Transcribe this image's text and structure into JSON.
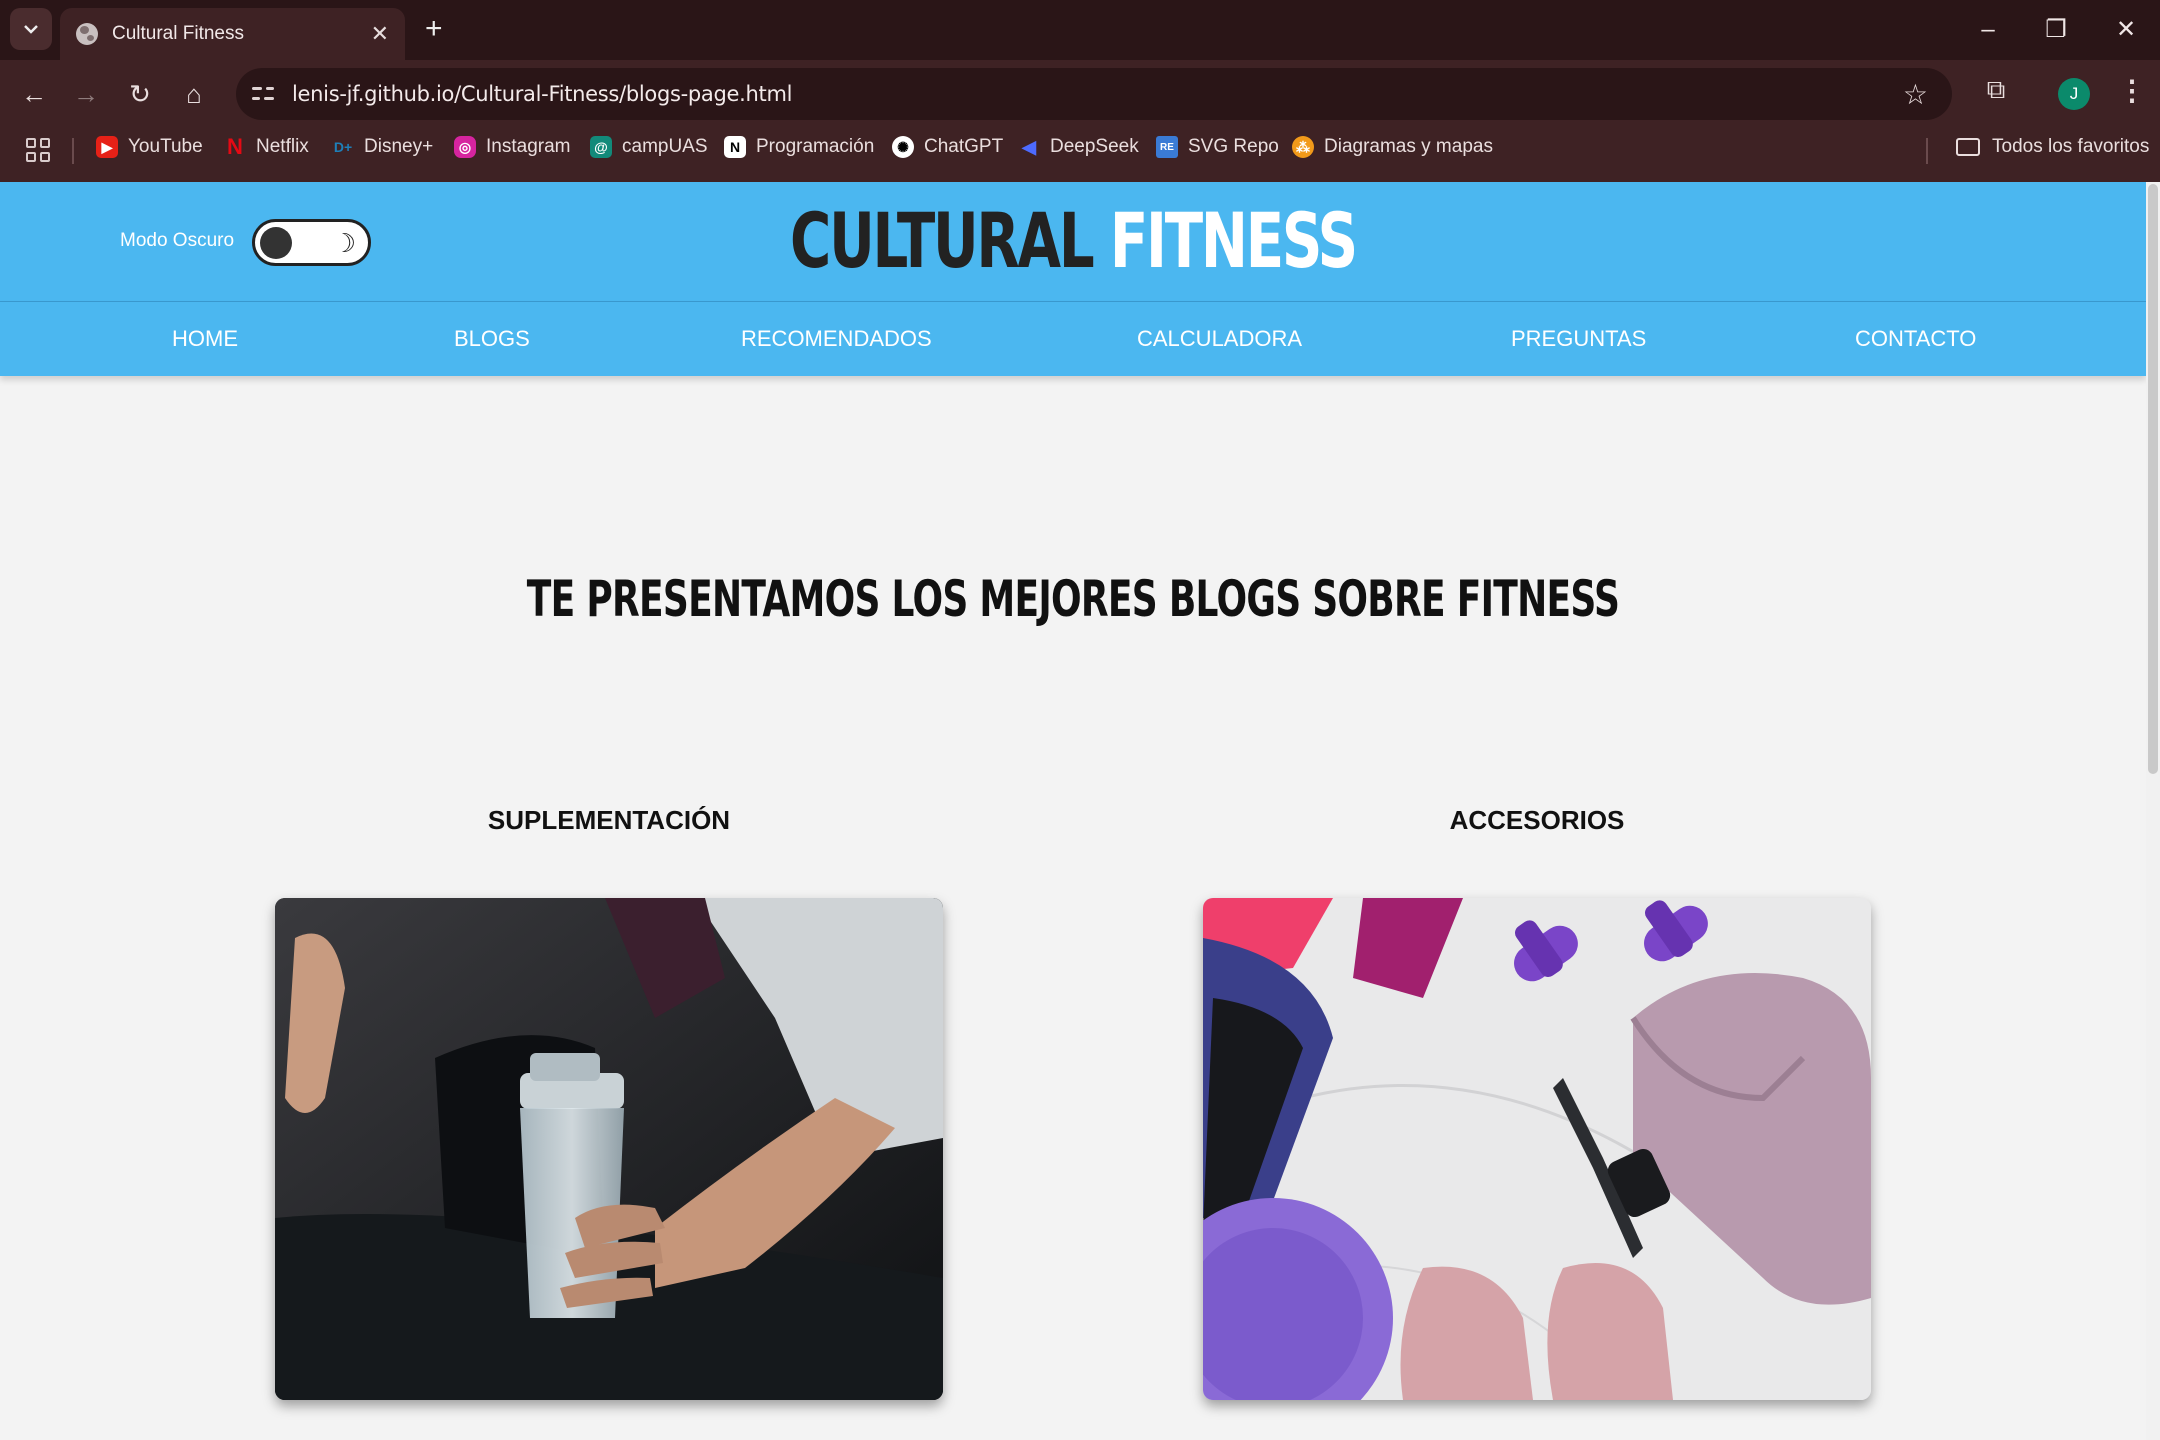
{
  "browser": {
    "tab_title": "Cultural Fitness",
    "url": "lenis-jf.github.io/Cultural-Fitness/blogs-page.html",
    "profile_initial": "J",
    "bookmarks": [
      "YouTube",
      "Netflix",
      "Disney+",
      "Instagram",
      "campUAS",
      "Programación",
      "ChatGPT",
      "DeepSeek",
      "SVG Repo",
      "Diagramas y mapas"
    ],
    "all_bookmarks": "Todos los favoritos"
  },
  "header": {
    "toggle_label": "Modo Oscuro",
    "brand_part1": "CULTURAL",
    "brand_part2": "FITNESS",
    "nav": [
      "HOME",
      "BLOGS",
      "RECOMENDADOS",
      "CALCULADORA",
      "PREGUNTAS",
      "CONTACTO"
    ]
  },
  "main": {
    "title": "TE PRESENTAMOS LOS MEJORES BLOGS SOBRE FITNESS",
    "cards": [
      {
        "title": "SUPLEMENTACIÓN",
        "image": "shaker-bottle-photo"
      },
      {
        "title": "ACCESORIOS",
        "image": "fitness-accessories-photo"
      }
    ]
  },
  "colors": {
    "header_bg": "#4bb7f0",
    "page_bg": "#f3f3f3",
    "chrome_bg": "#3e2224"
  }
}
